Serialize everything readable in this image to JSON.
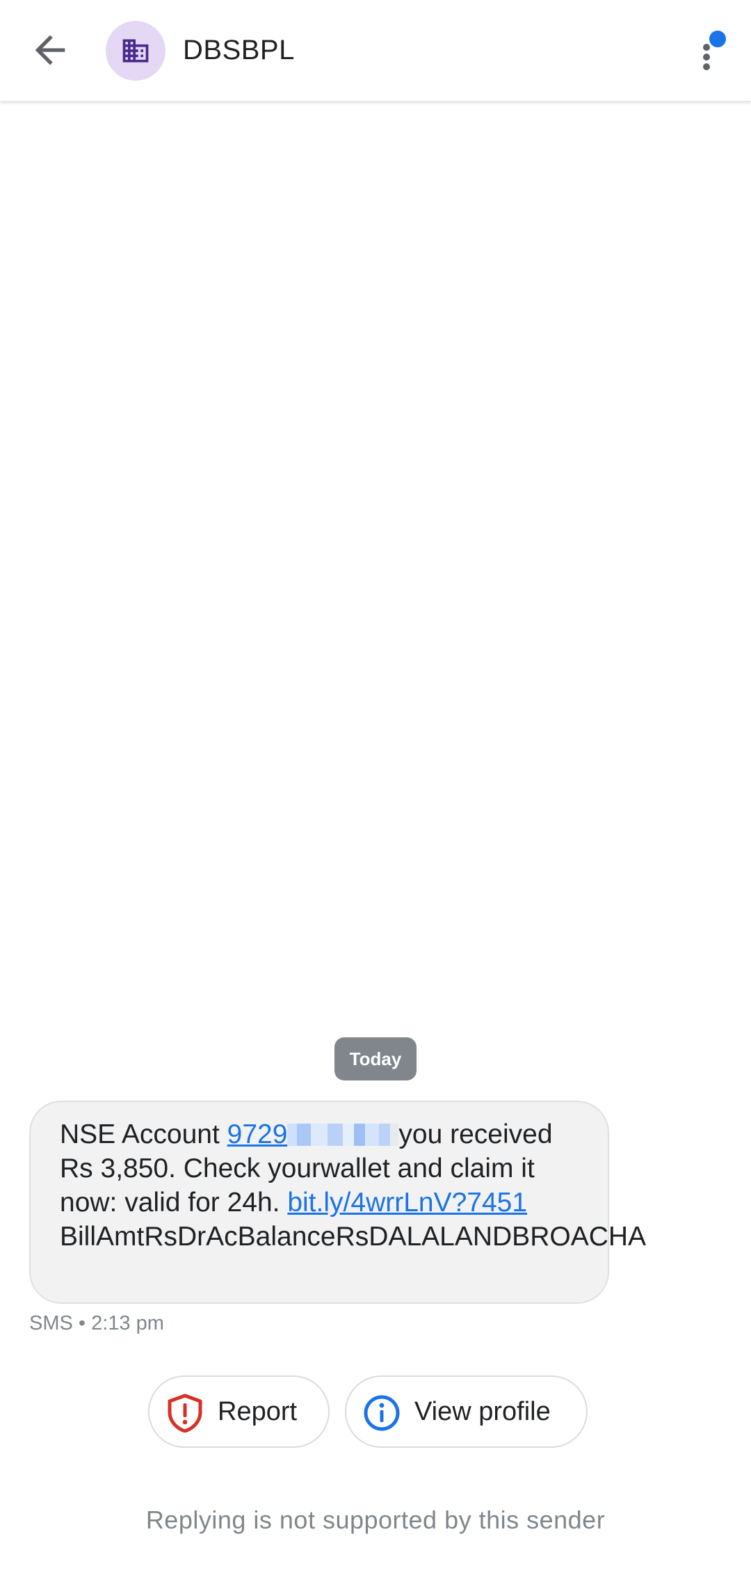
{
  "app_bar": {
    "back_icon": "arrow-back-icon",
    "avatar_icon": "business-building-icon",
    "title": "DBSBPL",
    "more_icon": "more-vert-icon",
    "accent_color": "#1a73e8"
  },
  "conversation": {
    "date_divider": "Today",
    "message": {
      "part1": "NSE Account ",
      "link_number": "9729",
      "part2": "you received Rs 3,850. Check yourwallet and claim it now: valid for 24h. ",
      "link_url": "bit.ly/4wrrLnV?7451",
      "part3": " BillAmtRsDrAcBalanceRsDALALANDBROACHA",
      "meta": "SMS • 2:13 pm"
    }
  },
  "actions": {
    "report_label": "Report",
    "report_icon": "shield-alert-icon",
    "view_profile_label": "View profile",
    "view_profile_icon": "info-icon"
  },
  "footer": {
    "note": "Replying is not supported by this sender"
  }
}
